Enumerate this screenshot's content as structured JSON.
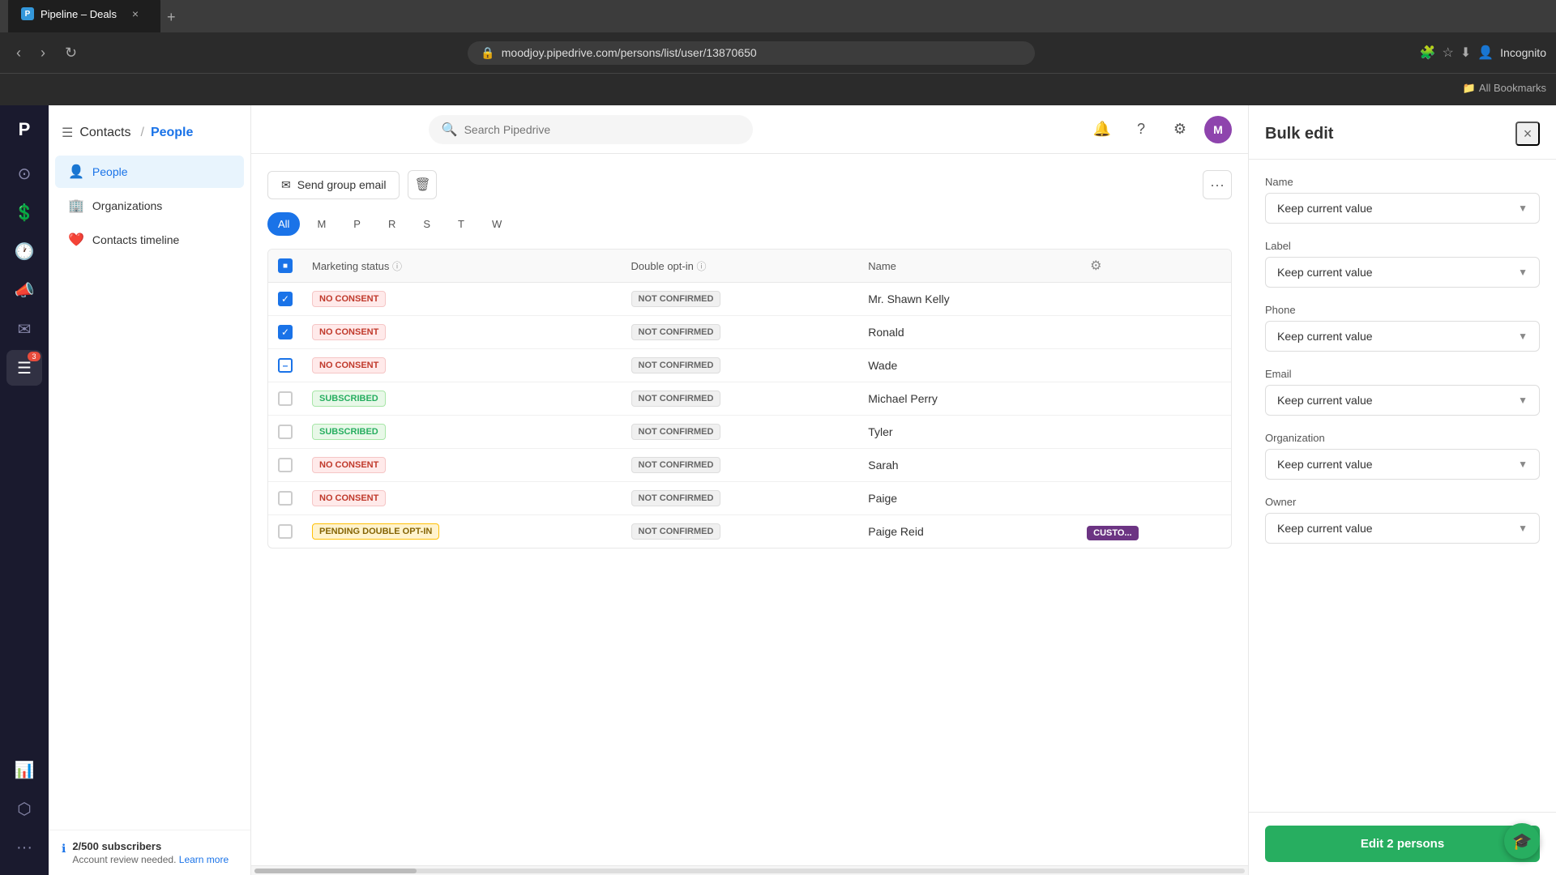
{
  "browser": {
    "tab_title": "Pipeline – Deals",
    "favicon_letter": "P",
    "url": "moodjoy.pipedrive.com/persons/list/user/13870650",
    "new_tab_label": "+",
    "bookmarks_label": "All Bookmarks"
  },
  "topbar": {
    "breadcrumb_parent": "Contacts",
    "breadcrumb_current": "People",
    "search_placeholder": "Search Pipedrive",
    "add_label": "+"
  },
  "sidebar": {
    "header_label": "Contacts",
    "items": [
      {
        "id": "people",
        "label": "People",
        "icon": "👤",
        "active": true
      },
      {
        "id": "organizations",
        "label": "Organizations",
        "icon": "🏢",
        "active": false
      },
      {
        "id": "contacts-timeline",
        "label": "Contacts timeline",
        "icon": "❤️",
        "active": false
      }
    ],
    "subscribers_count": "2/500 subscribers",
    "account_review": "Account review needed.",
    "learn_more": "Learn more"
  },
  "left_nav": {
    "icons": [
      {
        "id": "home",
        "icon": "⊙",
        "active": false
      },
      {
        "id": "deals",
        "icon": "$",
        "active": false
      },
      {
        "id": "activities",
        "icon": "⊕",
        "active": false
      },
      {
        "id": "campaigns",
        "icon": "📣",
        "active": false
      },
      {
        "id": "emails",
        "icon": "✉",
        "active": false
      },
      {
        "id": "contacts",
        "icon": "☰",
        "active": true,
        "badge": "3"
      },
      {
        "id": "reports",
        "icon": "📊",
        "active": false
      },
      {
        "id": "products",
        "icon": "⬡",
        "active": false
      }
    ]
  },
  "toolbar": {
    "send_group_email_label": "Send group email",
    "delete_icon": "🗑",
    "more_icon": "···"
  },
  "filters": {
    "items": [
      {
        "id": "all",
        "label": "All",
        "active": true
      },
      {
        "id": "m",
        "label": "M",
        "active": false
      },
      {
        "id": "p",
        "label": "P",
        "active": false
      },
      {
        "id": "r",
        "label": "R",
        "active": false
      },
      {
        "id": "s",
        "label": "S",
        "active": false
      },
      {
        "id": "t",
        "label": "T",
        "active": false
      },
      {
        "id": "w",
        "label": "W",
        "active": false
      }
    ]
  },
  "table": {
    "columns": [
      {
        "id": "select",
        "label": ""
      },
      {
        "id": "marketing_status",
        "label": "Marketing status",
        "has_info": true
      },
      {
        "id": "double_optin",
        "label": "Double opt-in",
        "has_info": true
      },
      {
        "id": "name",
        "label": "Name"
      }
    ],
    "rows": [
      {
        "id": 1,
        "checked": true,
        "marketing_status": "NO CONSENT",
        "marketing_class": "no-consent",
        "double_optin": "NOT CONFIRMED",
        "name": "Mr. Shawn Kelly",
        "custom": null
      },
      {
        "id": 2,
        "checked": true,
        "marketing_status": "NO CONSENT",
        "marketing_class": "no-consent",
        "double_optin": "NOT CONFIRMED",
        "name": "Ronald",
        "custom": null
      },
      {
        "id": 3,
        "checked": "partial",
        "marketing_status": "NO CONSENT",
        "marketing_class": "no-consent",
        "double_optin": "NOT CONFIRMED",
        "name": "Wade",
        "custom": null
      },
      {
        "id": 4,
        "checked": false,
        "marketing_status": "SUBSCRIBED",
        "marketing_class": "subscribed",
        "double_optin": "NOT CONFIRMED",
        "name": "Michael Perry",
        "custom": null
      },
      {
        "id": 5,
        "checked": false,
        "marketing_status": "SUBSCRIBED",
        "marketing_class": "subscribed",
        "double_optin": "NOT CONFIRMED",
        "name": "Tyler",
        "custom": null
      },
      {
        "id": 6,
        "checked": false,
        "marketing_status": "NO CONSENT",
        "marketing_class": "no-consent",
        "double_optin": "NOT CONFIRMED",
        "name": "Sarah",
        "custom": null
      },
      {
        "id": 7,
        "checked": false,
        "marketing_status": "NO CONSENT",
        "marketing_class": "no-consent",
        "double_optin": "NOT CONFIRMED",
        "name": "Paige",
        "custom": null
      },
      {
        "id": 8,
        "checked": false,
        "marketing_status": "PENDING DOUBLE OPT-IN",
        "marketing_class": "pending",
        "double_optin": "NOT CONFIRMED",
        "name": "Paige Reid",
        "custom": "CUSTO..."
      }
    ]
  },
  "bulk_edit": {
    "title": "Bulk edit",
    "close_icon": "×",
    "fields": [
      {
        "id": "name",
        "label": "Name",
        "value": "Keep current value"
      },
      {
        "id": "label",
        "label": "Label",
        "value": "Keep current value"
      },
      {
        "id": "phone",
        "label": "Phone",
        "value": "Keep current value"
      },
      {
        "id": "email",
        "label": "Email",
        "value": "Keep current value"
      },
      {
        "id": "organization",
        "label": "Organization",
        "value": "Keep current value"
      },
      {
        "id": "owner",
        "label": "Owner",
        "value": "Keep current value"
      }
    ],
    "submit_label": "Edit 2 persons"
  }
}
